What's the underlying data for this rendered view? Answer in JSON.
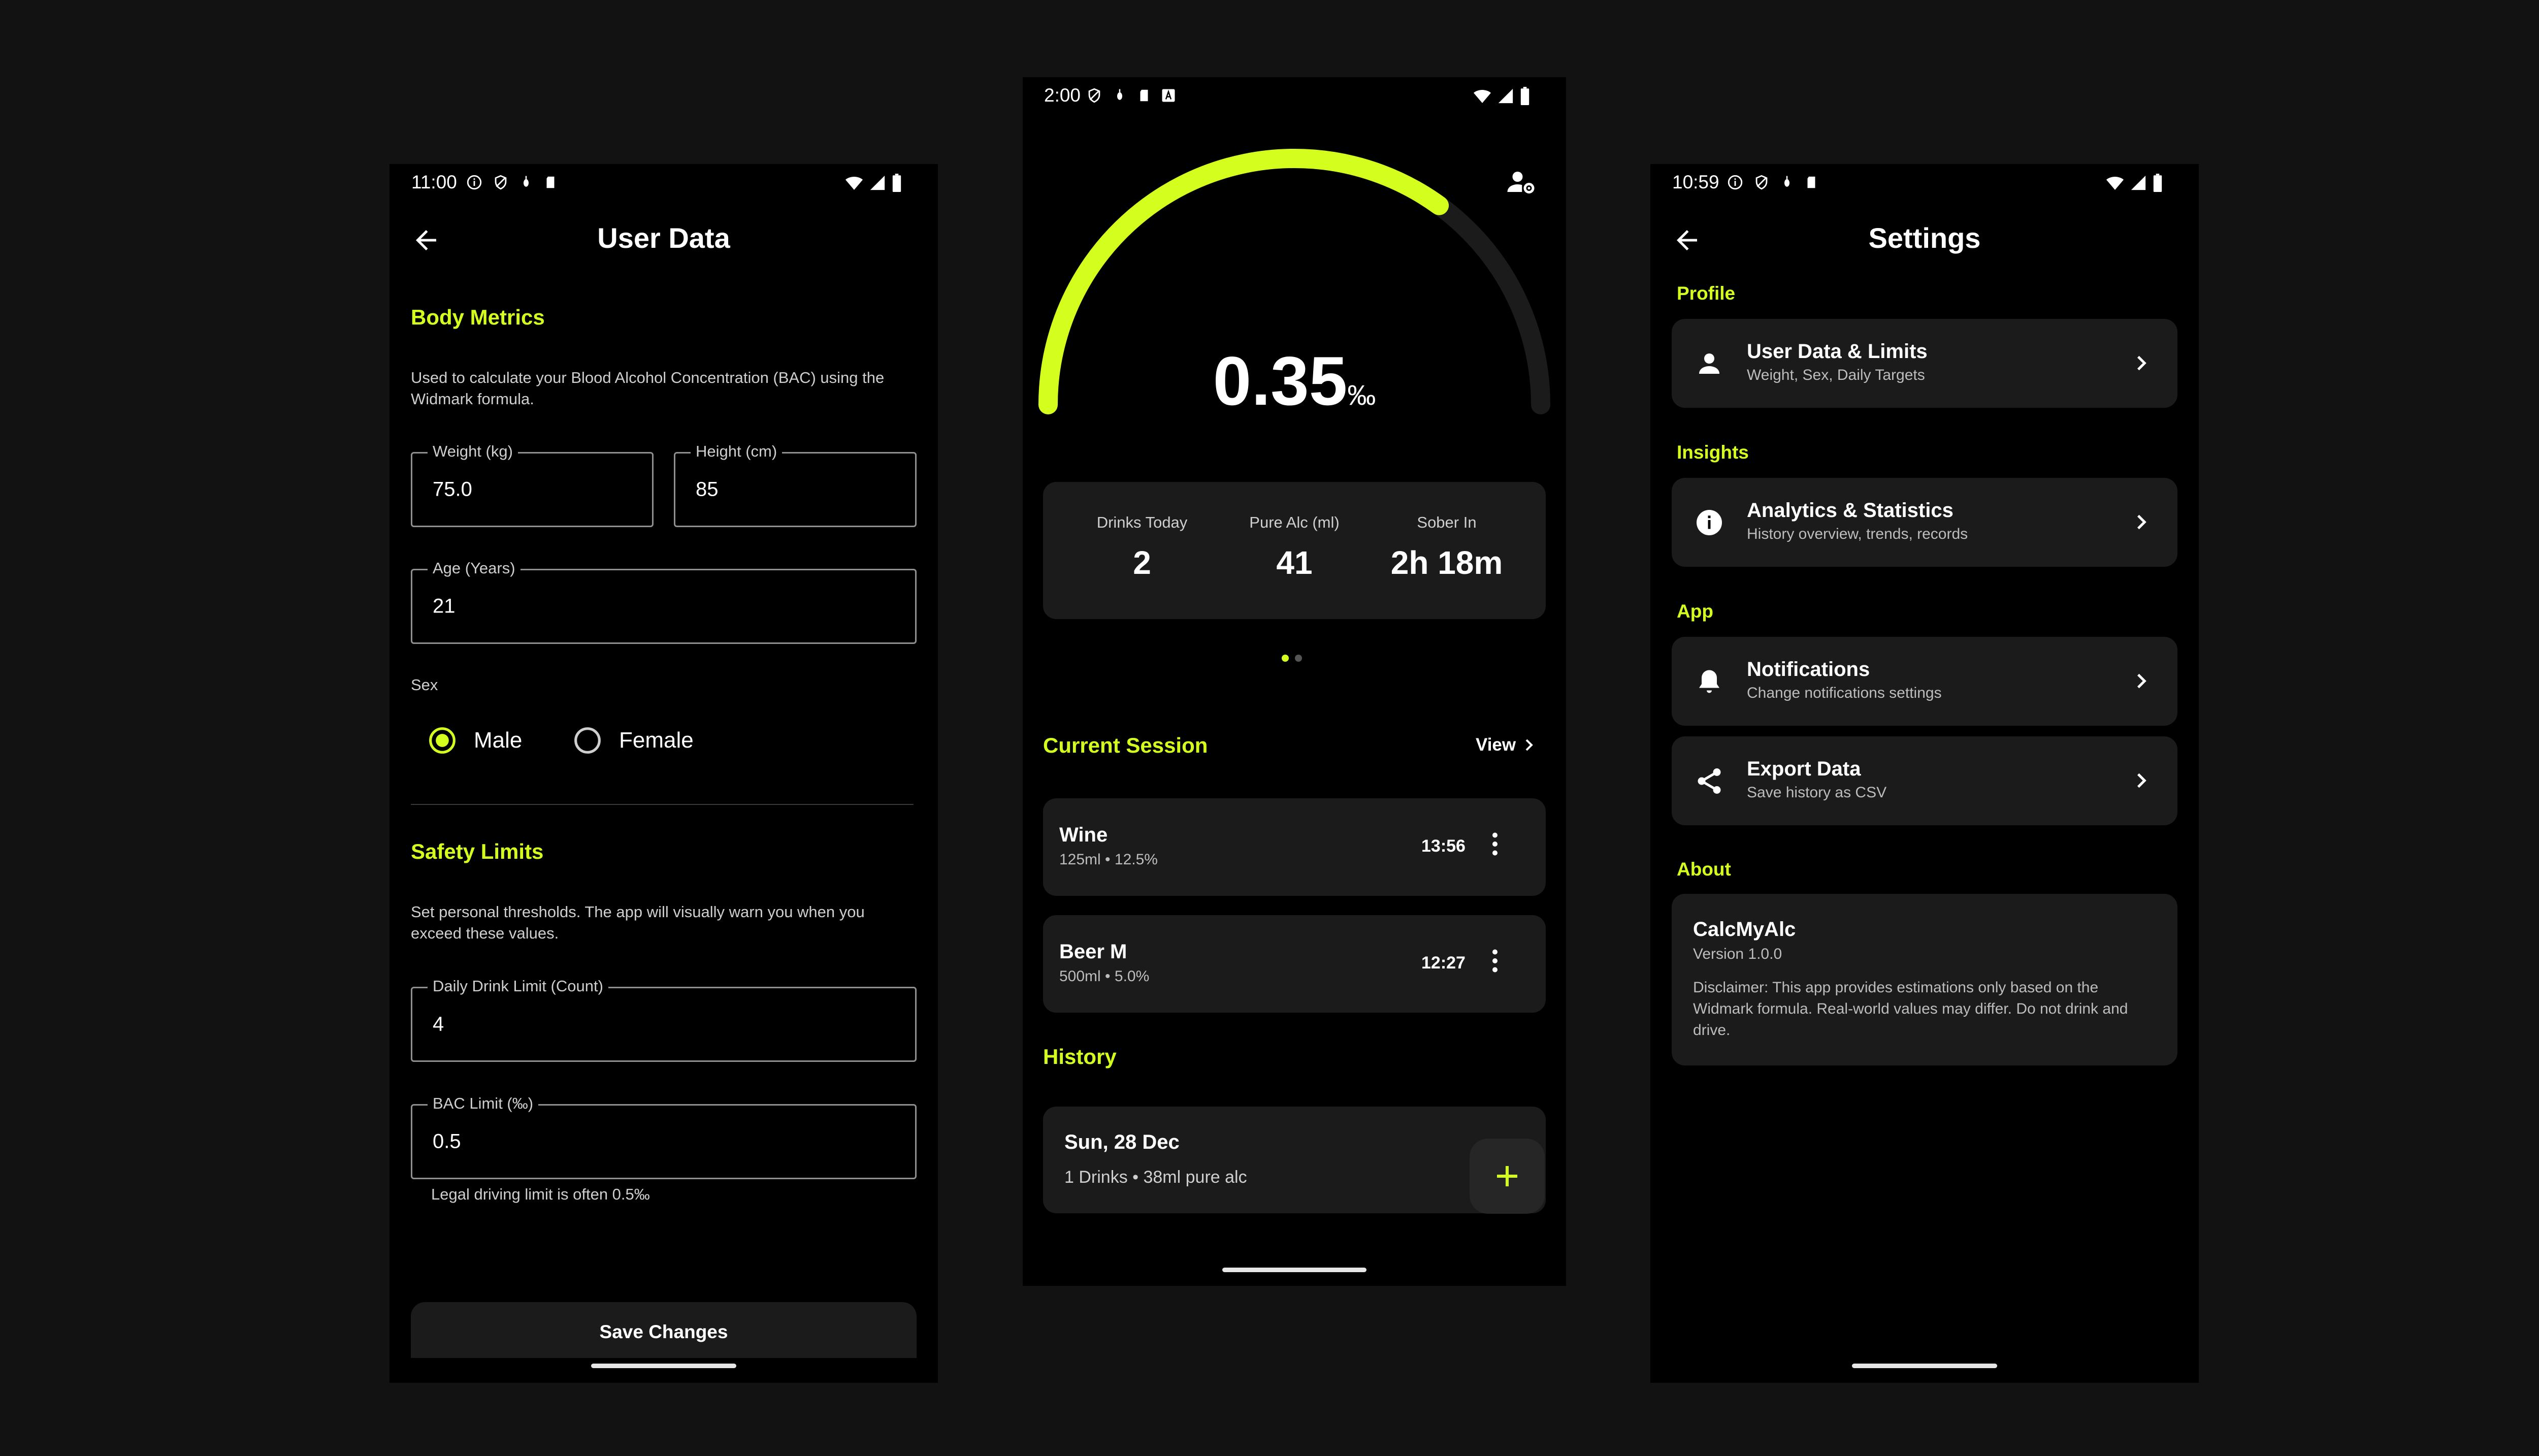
{
  "colors": {
    "accent": "#d4ff1e",
    "background": "#121212",
    "screen": "#000000",
    "card": "#1b1b1b"
  },
  "user_data": {
    "status_time": "11:00",
    "title": "User Data",
    "body_metrics": {
      "heading": "Body Metrics",
      "description": "Used to calculate your Blood Alcohol Concentration (BAC) using the Widmark formula.",
      "weight": {
        "label": "Weight (kg)",
        "value": "75.0"
      },
      "height": {
        "label": "Height (cm)",
        "value": "85"
      },
      "age": {
        "label": "Age (Years)",
        "value": "21"
      },
      "sex_label": "Sex",
      "sex_options": [
        "Male",
        "Female"
      ],
      "sex_selected": "Male"
    },
    "safety_limits": {
      "heading": "Safety Limits",
      "description": "Set personal thresholds. The app will visually warn you when you exceed these values.",
      "daily_limit": {
        "label": "Daily Drink Limit (Count)",
        "value": "4"
      },
      "bac_limit": {
        "label": "BAC Limit (‰)",
        "value": "0.5",
        "helper": "Legal driving limit is often 0.5‰"
      }
    },
    "save_label": "Save Changes"
  },
  "dashboard": {
    "status_time": "2:00",
    "bac_value": "0.35",
    "bac_unit": "‰",
    "gauge_fraction": 0.7,
    "stats": [
      {
        "label": "Drinks Today",
        "value": "2"
      },
      {
        "label": "Pure Alc (ml)",
        "value": "41"
      },
      {
        "label": "Sober In",
        "value": "2h 18m"
      }
    ],
    "page_indicator": {
      "count": 2,
      "active": 0
    },
    "current_session": {
      "heading": "Current Session",
      "view_label": "View",
      "drinks": [
        {
          "name": "Wine",
          "detail": "125ml • 12.5%",
          "time": "13:56"
        },
        {
          "name": "Beer M",
          "detail": "500ml • 5.0%",
          "time": "12:27"
        }
      ]
    },
    "history": {
      "heading": "History",
      "entries": [
        {
          "date": "Sun, 28 Dec",
          "summary": "1 Drinks • 38ml pure alc"
        }
      ]
    }
  },
  "settings": {
    "status_time": "10:59",
    "title": "Settings",
    "sections": {
      "profile": "Profile",
      "insights": "Insights",
      "app": "App",
      "about": "About"
    },
    "items": {
      "user_data": {
        "title": "User Data & Limits",
        "subtitle": "Weight, Sex, Daily Targets",
        "icon": "person-icon"
      },
      "analytics": {
        "title": "Analytics & Statistics",
        "subtitle": "History overview, trends, records",
        "icon": "info-icon"
      },
      "notifications": {
        "title": "Notifications",
        "subtitle": "Change notifications settings",
        "icon": "bell-icon"
      },
      "export": {
        "title": "Export Data",
        "subtitle": "Save history as CSV",
        "icon": "share-icon"
      }
    },
    "about": {
      "app_name": "CalcMyAlc",
      "version": "Version 1.0.0",
      "disclaimer": "Disclaimer: This app provides estimations only based on the Widmark formula. Real-world values may differ. Do not drink and drive."
    }
  }
}
